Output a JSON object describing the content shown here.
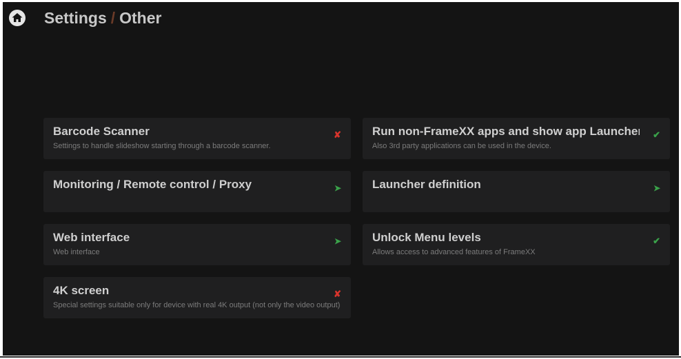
{
  "header": {
    "breadcrumb_root": "Settings",
    "breadcrumb_separator": "/",
    "breadcrumb_current": "Other"
  },
  "icons": {
    "home": "home-icon"
  },
  "colors": {
    "background": "#141414",
    "card": "#1f1f20",
    "enabled": "#3aa24a",
    "disabled": "#d8342c"
  },
  "cards": [
    {
      "title": "Barcode Scanner",
      "subtitle": "Settings to handle slideshow starting through a barcode scanner.",
      "state": "✘",
      "state_type": "disabled"
    },
    {
      "title": "Run non-FrameXX apps and show app Launcher",
      "subtitle": "Also 3rd party applications can be used in the device.",
      "state": "✔",
      "state_type": "enabled"
    },
    {
      "title": "Monitoring / Remote control / Proxy",
      "subtitle": "",
      "state": "➤",
      "state_type": "submenu"
    },
    {
      "title": "Launcher definition",
      "subtitle": "",
      "state": "➤",
      "state_type": "submenu"
    },
    {
      "title": "Web interface",
      "subtitle": "Web interface",
      "state": "➤",
      "state_type": "submenu"
    },
    {
      "title": "Unlock Menu levels",
      "subtitle": "Allows access to advanced features of FrameXX",
      "state": "✔",
      "state_type": "enabled"
    },
    {
      "title": "4K screen",
      "subtitle": "Special settings suitable only for device with real 4K output (not only the video output)",
      "state": "✘",
      "state_type": "disabled"
    }
  ]
}
